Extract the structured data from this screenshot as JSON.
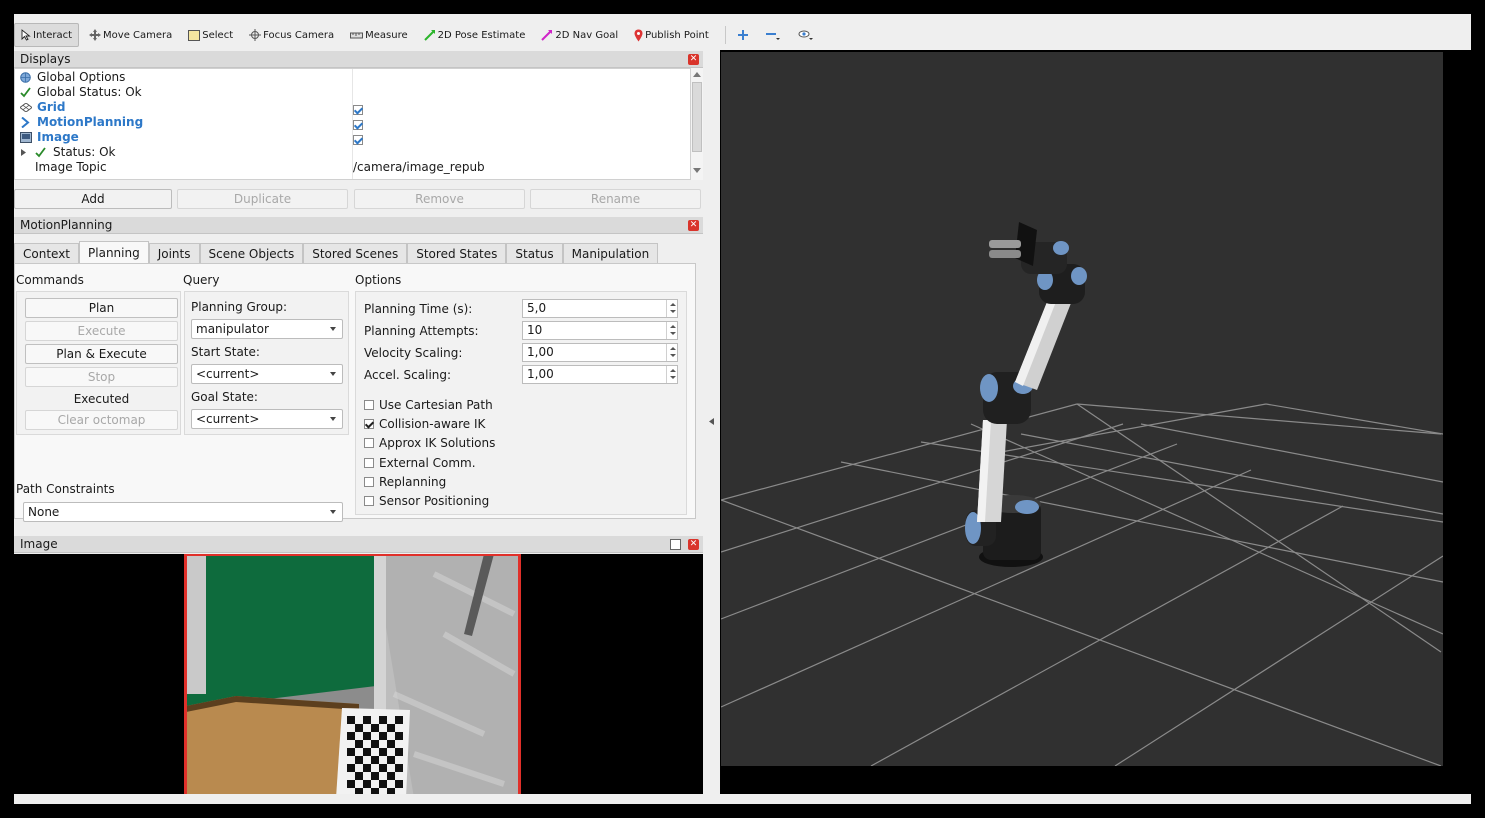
{
  "toolbar": {
    "tools": [
      {
        "label": "Interact",
        "icon": "cursor-icon",
        "active": true
      },
      {
        "label": "Move Camera",
        "icon": "move-icon"
      },
      {
        "label": "Select",
        "icon": "select-icon"
      },
      {
        "label": "Focus Camera",
        "icon": "focus-icon"
      },
      {
        "label": "Measure",
        "icon": "ruler-icon"
      },
      {
        "label": "2D Pose Estimate",
        "icon": "pose-arrow-icon"
      },
      {
        "label": "2D Nav Goal",
        "icon": "nav-arrow-icon"
      },
      {
        "label": "Publish Point",
        "icon": "pin-icon"
      }
    ]
  },
  "displays": {
    "title": "Displays",
    "rows": [
      {
        "label": "Global Options",
        "value": ""
      },
      {
        "label": "Global Status: Ok",
        "value": ""
      },
      {
        "label": "Grid",
        "value": ""
      },
      {
        "label": "MotionPlanning",
        "value": ""
      },
      {
        "label": "Image",
        "value": ""
      },
      {
        "label": "Status: Ok",
        "value": ""
      },
      {
        "label": "Image Topic",
        "value": "/camera/image_repub"
      }
    ],
    "buttons": {
      "add": "Add",
      "duplicate": "Duplicate",
      "remove": "Remove",
      "rename": "Rename"
    }
  },
  "motion_planning": {
    "title": "MotionPlanning",
    "tabs": [
      "Context",
      "Planning",
      "Joints",
      "Scene Objects",
      "Stored Scenes",
      "Stored States",
      "Status",
      "Manipulation"
    ],
    "commands": {
      "title": "Commands",
      "plan": "Plan",
      "execute": "Execute",
      "plan_execute": "Plan & Execute",
      "stop": "Stop",
      "status": "Executed",
      "clear_octomap": "Clear octomap"
    },
    "query": {
      "title": "Query",
      "planning_group_label": "Planning Group:",
      "planning_group": "manipulator",
      "start_state_label": "Start State:",
      "start_state": "<current>",
      "goal_state_label": "Goal State:",
      "goal_state": "<current>"
    },
    "path_constraints": {
      "title": "Path Constraints",
      "value": "None"
    },
    "options": {
      "title": "Options",
      "planning_time_label": "Planning Time (s):",
      "planning_time": "5,0",
      "planning_attempts_label": "Planning Attempts:",
      "planning_attempts": "10",
      "velocity_scaling_label": "Velocity Scaling:",
      "velocity_scaling": "1,00",
      "accel_scaling_label": "Accel. Scaling:",
      "accel_scaling": "1,00",
      "checks": [
        {
          "label": "Use Cartesian Path",
          "checked": false
        },
        {
          "label": "Collision-aware IK",
          "checked": true
        },
        {
          "label": "Approx IK Solutions",
          "checked": false
        },
        {
          "label": "External Comm.",
          "checked": false
        },
        {
          "label": "Replanning",
          "checked": false
        },
        {
          "label": "Sensor Positioning",
          "checked": false
        }
      ]
    }
  },
  "image_panel": {
    "title": "Image"
  },
  "colors": {
    "accent_blue": "#2d78c8",
    "close_red": "#d9342b",
    "viewport_bg": "#303030",
    "highlight_red": "#e0302a"
  }
}
